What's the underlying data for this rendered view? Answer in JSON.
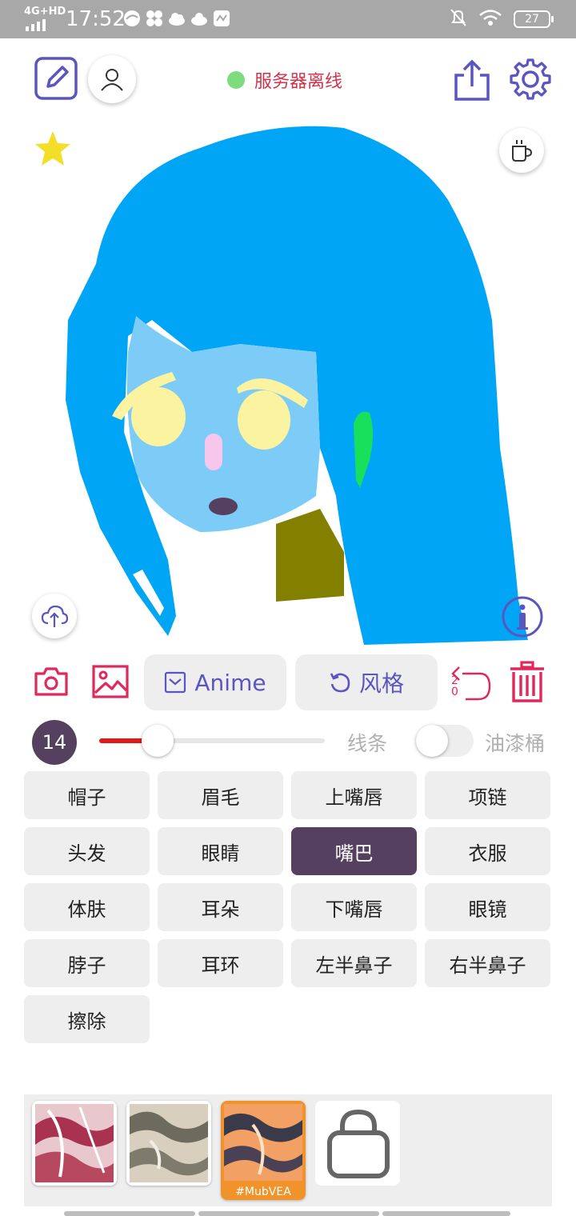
{
  "status_bar": {
    "network": "4G+HD",
    "time": "17:52",
    "battery": "27"
  },
  "header": {
    "server_status": "服务器离线",
    "server_status_color": "#7ddc7d"
  },
  "toolbar": {
    "anime_label": "Anime",
    "style_label": "风格",
    "undo_count": "20"
  },
  "brush": {
    "size": "14",
    "slider_fraction": 0.26,
    "line_label": "线条",
    "bucket_label": "油漆桶",
    "bucket_enabled": false
  },
  "parts": [
    {
      "label": "帽子",
      "active": false
    },
    {
      "label": "眉毛",
      "active": false
    },
    {
      "label": "上嘴唇",
      "active": false
    },
    {
      "label": "项链",
      "active": false
    },
    {
      "label": "头发",
      "active": false
    },
    {
      "label": "眼睛",
      "active": false
    },
    {
      "label": "嘴巴",
      "active": true
    },
    {
      "label": "衣服",
      "active": false
    },
    {
      "label": "体肤",
      "active": false
    },
    {
      "label": "耳朵",
      "active": false
    },
    {
      "label": "下嘴唇",
      "active": false
    },
    {
      "label": "眼镜",
      "active": false
    },
    {
      "label": "脖子",
      "active": false
    },
    {
      "label": "耳环",
      "active": false
    },
    {
      "label": "左半鼻子",
      "active": false
    },
    {
      "label": "右半鼻子",
      "active": false
    },
    {
      "label": "擦除",
      "active": false
    }
  ],
  "styles": {
    "selected_caption": "#MubVEA"
  },
  "colors": {
    "accent_purple": "#5b55c0",
    "accent_red": "#e0285a",
    "active_part": "#55405f",
    "hair": "#00a6f5",
    "skin": "#7dccf8",
    "eyes": "#fcf3a0",
    "clothes": "#838000"
  }
}
